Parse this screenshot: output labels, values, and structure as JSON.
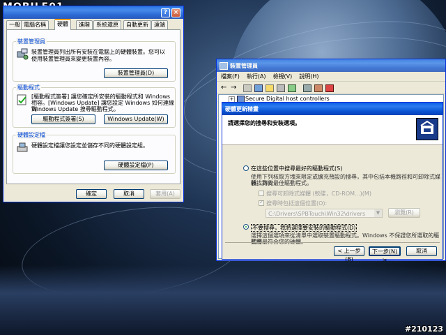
{
  "watermark": {
    "logo": "MOBILE01",
    "logo_sub": "",
    "id": "#210123"
  },
  "sys_props": {
    "title": "",
    "tabs": [
      "一般",
      "電腦名稱",
      "硬體",
      "進階",
      "系統還原",
      "自動更新",
      "遠端"
    ],
    "active_tab": "硬體",
    "device_manager": {
      "label": "裝置管理員",
      "desc_1": "裝置管理員列出所有安裝在電腦上的硬體裝置。您可以",
      "desc_2": "使用裝置管理員來變更裝置內容。",
      "button": "裝置管理員(D)"
    },
    "drivers": {
      "label": "驅動程式",
      "desc_1": "[驅動程式簽署] 讓您確定所安裝的驅動程式和 Windows",
      "desc_2": "相容。[Windows Update] 讓您設定 Windows 如何連線到",
      "desc_3": "Windows Update 搜尋驅動程式。",
      "sign_button": "驅動程式簽署(S)",
      "update_button": "Windows Update(W)"
    },
    "profiles": {
      "label": "硬體設定檔",
      "desc": "硬體設定檔讓您設定並儲存不同的硬體設定組。",
      "button": "硬體設定檔(P)"
    },
    "ok": "確定",
    "cancel": "取消",
    "apply": "套用(A)"
  },
  "device_mgr": {
    "title": "裝置管理員",
    "menu": [
      "檔案(F)",
      "執行(A)",
      "檢視(V)",
      "說明(H)"
    ],
    "tree_item": "Secure Digital host controllers"
  },
  "wizard": {
    "title": "硬體更新精靈",
    "header": "請選擇您的搜尋和安裝選項。",
    "opt1_label": "在這些位置中搜尋最好的驅動程式(S)",
    "opt1_desc_1": "使用下列核取方塊來限定或擴充預設的搜尋，其中包括本機路徑和可卸除式媒體。將安",
    "opt1_desc_2": "裝找到的最佳驅動程式。",
    "check1": "搜尋可卸除式媒體 (軟碟，CD-ROM...)(M)",
    "check2": "搜尋時包括這個位置(O):",
    "path": "C:\\Drivers\\SPBTouch\\Win32\\drivers",
    "browse": "瀏覽(R)",
    "opt2_label": "不要搜尋，我將選擇要安裝的驅動程式(D)",
    "opt2_desc_1": "選擇這個選項來從清單中選取裝置驅動程式。Windows 不保證您所選取的驅動程",
    "opt2_desc_2": "式將最符合您的硬體。",
    "back": "< 上一步(B)",
    "next": "下一步(N) >",
    "cancel": "取消",
    "selected_option": 2
  }
}
